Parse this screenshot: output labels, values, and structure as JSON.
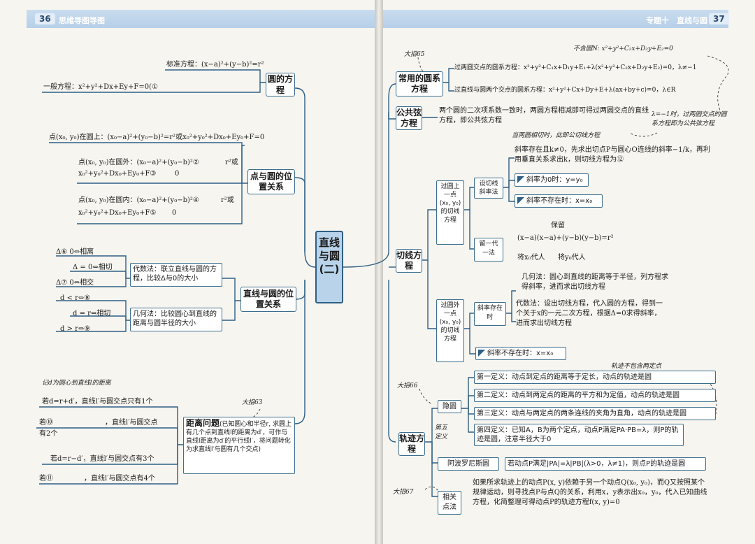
{
  "header": {
    "left_page_num": "36",
    "left_band": "思维导图导图",
    "right_band_1": "专题十",
    "right_band_2": "直线与圆",
    "right_page_num": "37"
  },
  "center_title": "直线与圆(二)",
  "left": {
    "circle_eq": {
      "label": "圆的方程",
      "standard": "标准方程：(x−a)²+(y−b)²=r²",
      "general": "一般方程：x²+y²+Dx+Ey+F=0(①"
    },
    "point_circle": {
      "label": "点与圆的位置关系",
      "on": "点(x₀, y₀)在圆上：(x₀−a)²+(y₀−b)²=r²或x₀²+y₀²+Dx₀+Ey₀+F=0",
      "out_1": "点(x₀, y₀)在圆外：(x₀−a)²+(y₀−b)²②",
      "out_1b": "r²或",
      "out_2": "x₀²+y₀²+Dx₀+Ey₀+F③",
      "out_2b": "0",
      "in_1": "点(x₀, y₀)在圆内：(x₀−a)²+(y₀−b)²④",
      "in_1b": "r²或",
      "in_2": "x₀²+y₀²+Dx₀+Ey₀+F⑤",
      "in_2b": "0"
    },
    "line_circle": {
      "label": "直线与圆的位置关系",
      "algebra": "代数法：联立直线与圆的方程，比较Δ与0的大小",
      "geometry": "几何法：比较圆心到直线的距离与圆半径的大小",
      "d1": "Δ⑥     0⇔相离",
      "d2": "Δ = 0⇔相切",
      "d3": "Δ⑦     0⇔相交",
      "r1": "d < r⇔⑧",
      "r2": "d = r⇔相切",
      "r3": "d > r⇔⑨"
    },
    "distance": {
      "tag": "大招63",
      "note": "记d为圆心到直线l的距离",
      "title": "距离问题",
      "body": "(已知圆心和半径r, 求圆上有几个点到直线l的距离为d′，可作与直线l距离为d′的平行线l′，将问题转化为求直线l′与圆有几个交点)",
      "c1": "若d=r+d′，直线l′与圆交点只有1个",
      "c2a": "若⑩",
      "c2b": "，直线l′与圆交点",
      "c2c": "有2个",
      "c3": "若d=r−d′，直线l′与圆交点有3个",
      "c4a": "若⑪",
      "c4b": "，直线l′与圆交点有4个"
    }
  },
  "right": {
    "common_circle": {
      "tag": "大招65",
      "label": "常用的圆系方程",
      "note_top": "不含圆N: x²+y²+C₂x+D₂y+E₂=0",
      "e1": "过两圆交点的圆系方程：x²+y²+C₁x+D₁y+E₁+λ(x²+y²+C₂x+D₂y+E₂)=0，λ≠−1",
      "e2": "过直线与圆两个交点的圆系方程：x²+y²+Cx+Dy+E+λ(ax+by+c)=0，λ∈R"
    },
    "chord": {
      "label": "公共弦方程",
      "body": "两个圆的二次项系数一致时，两圆方程相减即可得过两圆交点的直线方程，即公共弦方程",
      "note1": "λ=−1时，过两圆交点的圆系方程即为公共弦方程",
      "note2": "当两圆相切时，此即公切线方程"
    },
    "tangent": {
      "label": "切线方程",
      "on_label": "过圆上一点(x₀, y₀)的切线方程",
      "slope_set": "设切线斜率法",
      "slope_exists": "斜率存在且k≠0，先求出切点P与圆心O连线的斜率−1/k，再利用垂直关系求出k，则切线方程为⑫",
      "slope_zero": "斜率为0时：y=y₀",
      "slope_none": "斜率不存在时：x=x₀",
      "keep_label": "留一代一法",
      "keep_top": "保留",
      "keep_formula": "(x−a)(x−a)+(y−b)(y−b)=r²",
      "keep_x": "将x₀代人",
      "keep_y": "将y₀代人",
      "out_label": "过圆外一点(x₀, y₀)的切线方程",
      "out_exists": "斜率存在时",
      "geo": "几何法：圆心到直线的距离等于半径，列方程求得斜率，进而求出切线方程",
      "alg": "代数法：设出切线方程，代入圆的方程，得到一个关于x的一元二次方程，根据Δ=0求得斜率，进而求出切线方程",
      "out_none": "斜率不存在时：x=x₀"
    },
    "locus": {
      "tag66": "大招66",
      "tag67": "大招67",
      "label": "轨迹方程",
      "note": "轨迹不包含两定点",
      "hidden": "隐圆",
      "fifth": "第五定义",
      "d1": "第一定义：动点到定点的距离等于定长，动点的轨迹是圆",
      "d2": "第二定义：动点到两定点的距离的平方和为定值，动点的轨迹是圆",
      "d3": "第三定义：动点与两定点的两条连线的夹角为直角，动点的轨迹是圆",
      "d4": "第四定义：已知A，B为两个定点，动点P满足PA·PB=λ，则P的轨迹是圆，注意半径大于0",
      "apollo": "阿波罗尼斯圆",
      "apollo_body": "若动点P满足|PA|=λ|PB|(λ>0，λ≠1)，则点P的轨迹是圆",
      "related": "相关点法",
      "related_body": "如果所求轨迹上的动点P(x, y)依赖于另一个动点Q(x₀, y₀)，而Q又按照某个规律运动，则寻找点P与点Q的关系，利用x，y表示出x₀，y₀，代入已知曲线方程，化简整理可得动点P的轨迹方程f(x, y)=0"
    }
  }
}
